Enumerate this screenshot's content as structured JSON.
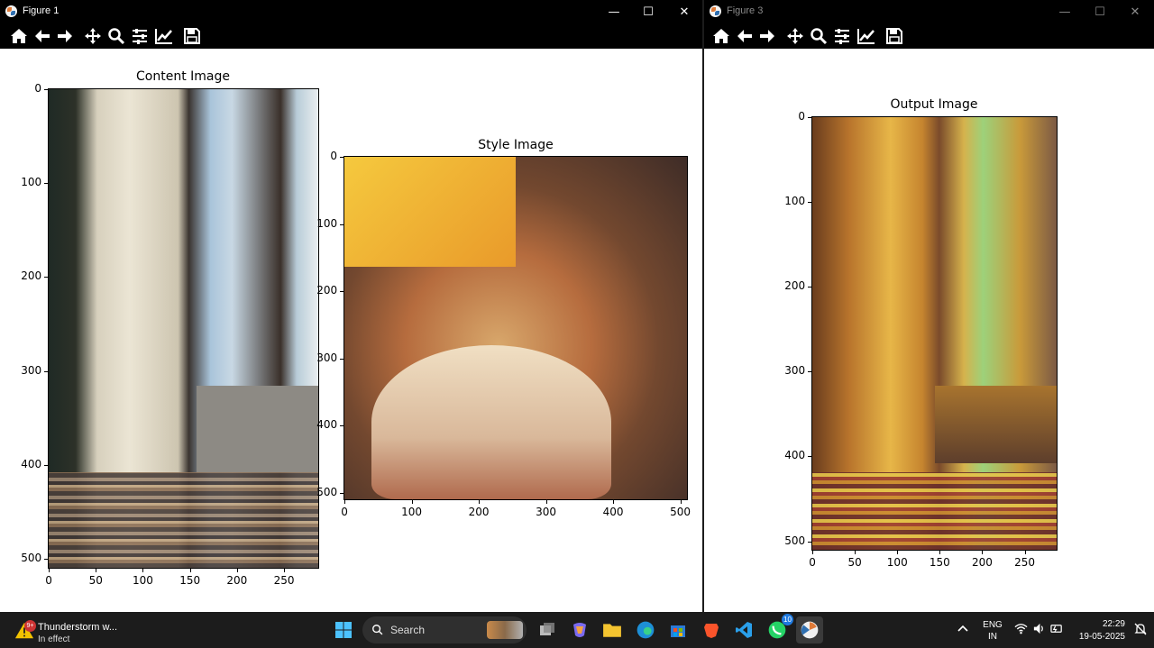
{
  "figure1": {
    "title": "Figure 1",
    "toolbar": [
      "home-icon",
      "back-arrow-icon",
      "forward-arrow-icon",
      "pan-icon",
      "zoom-icon",
      "configure-subplots-icon",
      "edit-axis-icon",
      "save-icon"
    ],
    "content": {
      "title": "Content Image",
      "xticks": [
        "0",
        "50",
        "100",
        "150",
        "200",
        "250"
      ],
      "yticks": [
        "0",
        "100",
        "200",
        "300",
        "400",
        "500"
      ]
    },
    "style": {
      "title": "Style Image",
      "xticks": [
        "0",
        "100",
        "200",
        "300",
        "400",
        "500"
      ],
      "yticks": [
        "0",
        "100",
        "200",
        "300",
        "400",
        "500"
      ]
    }
  },
  "figure3": {
    "title": "Figure 3",
    "output": {
      "title": "Output Image",
      "xticks": [
        "0",
        "50",
        "100",
        "150",
        "200",
        "250"
      ],
      "yticks": [
        "0",
        "100",
        "200",
        "300",
        "400",
        "500"
      ]
    }
  },
  "taskbar": {
    "weather_title": "Thunderstorm w...",
    "weather_sub": "In effect",
    "weather_badge": "9+",
    "search_placeholder": "Search",
    "whatsapp_badge": "10",
    "lang_top": "ENG",
    "lang_bottom": "IN",
    "time": "22:29",
    "date": "19-05-2025"
  }
}
